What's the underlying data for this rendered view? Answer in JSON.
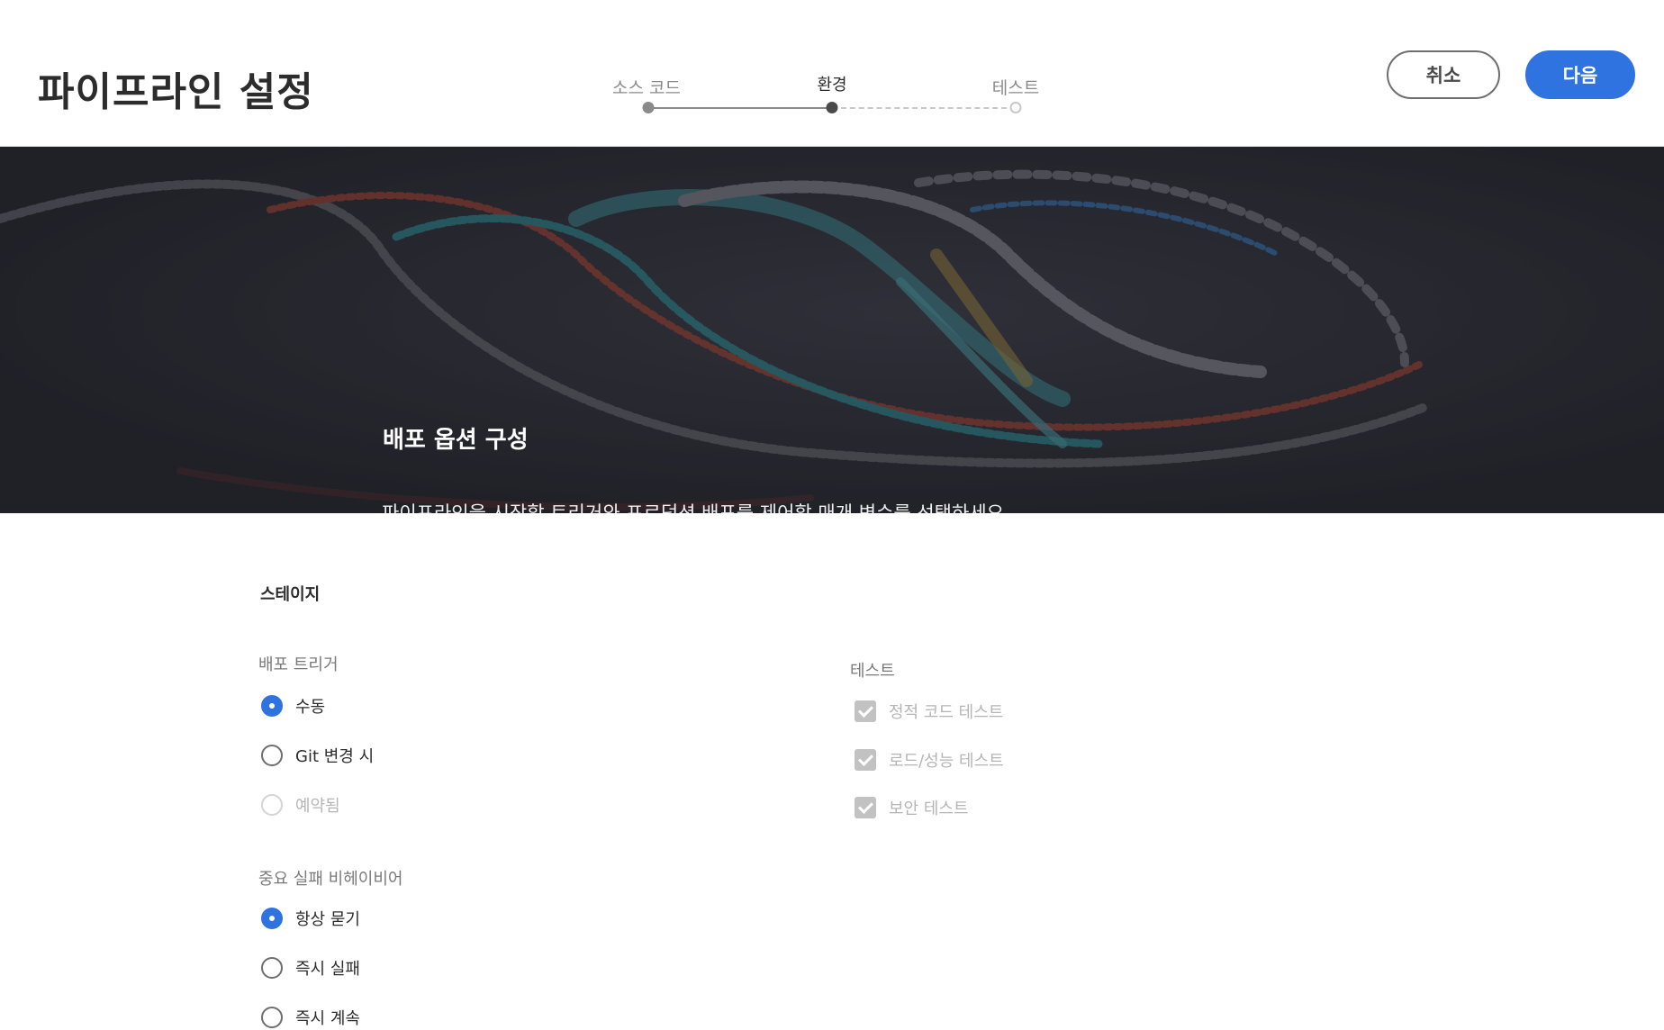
{
  "header": {
    "title": "파이프라인 설정",
    "steps": [
      {
        "label": "소스 코드",
        "state": "done"
      },
      {
        "label": "환경",
        "state": "current"
      },
      {
        "label": "테스트",
        "state": "todo"
      }
    ],
    "cancel_label": "취소",
    "next_label": "다음"
  },
  "hero": {
    "title": "배포 옵션 구성",
    "description": "파이프라인을 시작할 트리거와 프로덕션 배포를 제어할 매개 변수를 선택하세요."
  },
  "form": {
    "section_title": "스테이지",
    "trigger": {
      "label": "배포 트리거",
      "options": [
        {
          "label": "수동",
          "selected": true,
          "disabled": false
        },
        {
          "label": "Git 변경 시",
          "selected": false,
          "disabled": false
        },
        {
          "label": "예약됨",
          "selected": false,
          "disabled": true
        }
      ]
    },
    "failure": {
      "label": "중요 실패 비헤이비어",
      "options": [
        {
          "label": "항상 묻기",
          "selected": true
        },
        {
          "label": "즉시 실패",
          "selected": false
        },
        {
          "label": "즉시 계속",
          "selected": false
        }
      ]
    },
    "tests": {
      "label": "테스트",
      "options": [
        {
          "label": "정적 코드 테스트",
          "checked": true,
          "disabled": true
        },
        {
          "label": "로드/성능 테스트",
          "checked": true,
          "disabled": true
        },
        {
          "label": "보안 테스트",
          "checked": true,
          "disabled": true
        }
      ]
    }
  },
  "colors": {
    "accent": "#2f73e0",
    "hero_bg": "#25252c"
  }
}
